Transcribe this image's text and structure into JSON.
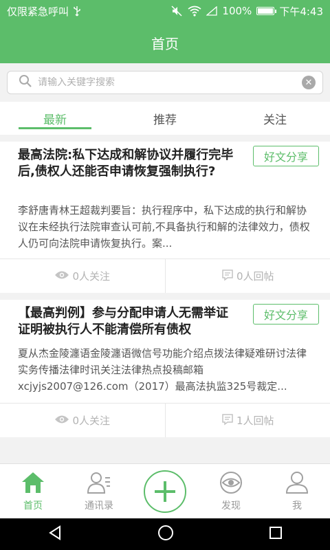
{
  "status_bar": {
    "carrier": "仅限紧急呼叫",
    "battery": "100%",
    "time": "下午4:43"
  },
  "header": {
    "title": "首页"
  },
  "search": {
    "placeholder": "请输入关键字搜索"
  },
  "tabs": [
    {
      "label": "最新",
      "active": true
    },
    {
      "label": "推荐",
      "active": false
    },
    {
      "label": "关注",
      "active": false
    }
  ],
  "articles": [
    {
      "title": "最高法院:私下达成和解协议并履行完毕后,债权人还能否申请恢复强制执行?",
      "share_label": "好文分享",
      "summary": "李舒唐青林王超裁判要旨：执行程序中，私下达成的执行和解协议在未经执行法院审查认可前,不具备执行和解的法律效力，债权人仍可向法院申请恢复执行。案...",
      "follow": "0人关注",
      "replies": "0人回帖"
    },
    {
      "title": "【最高判例】参与分配申请人无需举证证明被执行人不能清偿所有债权",
      "share_label": "好文分享",
      "summary": "夏从杰金陵瀍语金陵瀍语微信号功能介绍点拨法律疑难研讨法律实务传播法律时讯关注法律热点投稿邮箱xcjyjs2007@126.com（2017）最高法执监325号裁定...",
      "follow": "0人关注",
      "replies": "1人回帖"
    }
  ],
  "bottom_nav": [
    {
      "label": "首页",
      "icon": "home-icon",
      "active": true
    },
    {
      "label": "通讯录",
      "icon": "contacts-icon",
      "active": false
    },
    {
      "label": "",
      "icon": "add-icon",
      "active": false
    },
    {
      "label": "发现",
      "icon": "discover-eye-icon",
      "active": false
    },
    {
      "label": "我",
      "icon": "profile-icon",
      "active": false
    }
  ],
  "colors": {
    "accent": "#5cbd6a",
    "muted": "#b3b3b3"
  }
}
